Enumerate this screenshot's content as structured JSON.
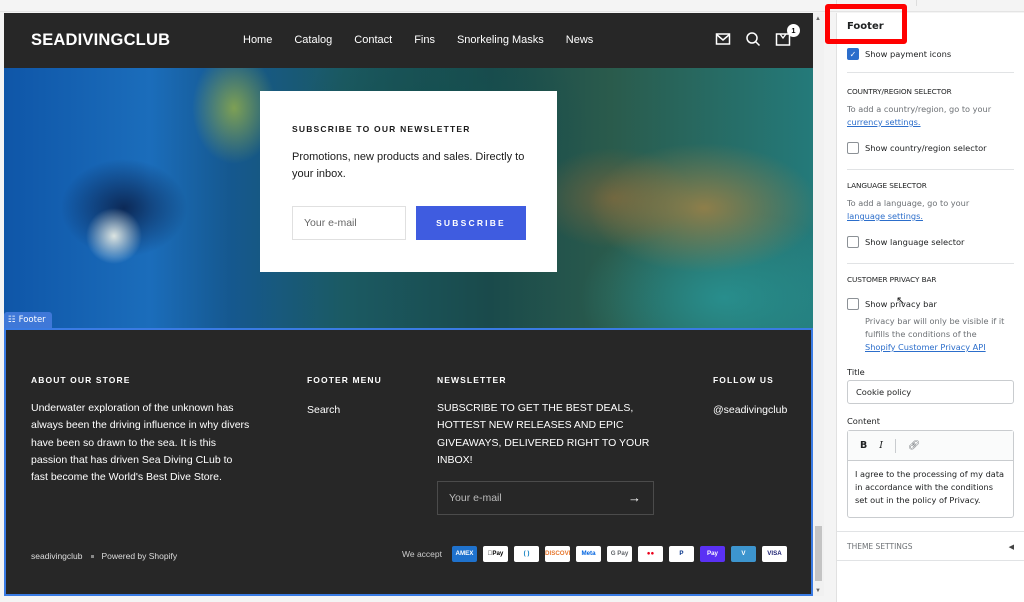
{
  "store": {
    "logo": "SEADIVINGCLUB",
    "nav": [
      "Home",
      "Catalog",
      "Contact",
      "Fins",
      "Snorkeling Masks",
      "News"
    ],
    "header_icons": [
      "mail-icon",
      "search-icon",
      "cart-icon"
    ],
    "cart_count": "1"
  },
  "hero_newsletter": {
    "title": "SUBSCRIBE TO OUR NEWSLETTER",
    "description": "Promotions, new products and sales. Directly to your inbox.",
    "email_placeholder": "Your e-mail",
    "button_label": "SUBSCRIBE",
    "button_color": "#3f5ce0"
  },
  "section_tag": "Footer",
  "footer": {
    "about": {
      "heading": "ABOUT OUR STORE",
      "text": "Underwater exploration of the unknown has always been the driving influence in why divers have been so drawn to the sea. It is this passion that has driven Sea Diving CLub to fast become the World's Best Dive Store."
    },
    "menu": {
      "heading": "FOOTER MENU",
      "links": [
        "Search"
      ]
    },
    "newsletter": {
      "heading": "NEWSLETTER",
      "text": "SUBSCRIBE TO GET THE BEST DEALS, HOTTEST NEW RELEASES AND EPIC GIVEAWAYS, DELIVERED RIGHT TO YOUR INBOX!",
      "email_placeholder": "Your e-mail",
      "submit_icon": "arrow-right-icon"
    },
    "follow": {
      "heading": "FOLLOW US",
      "handle": "@seadivingclub"
    },
    "copyright": "seadivingclub",
    "powered": "Powered by Shopify",
    "we_accept": "We accept",
    "payments": [
      {
        "name": "American Express",
        "label": "AMEX",
        "bg": "#1f72cd",
        "fg": "#ffffff"
      },
      {
        "name": "Apple Pay",
        "label": "Pay",
        "bg": "#ffffff",
        "fg": "#000000"
      },
      {
        "name": "Diners Club",
        "label": "( )",
        "bg": "#ffffff",
        "fg": "#0079be"
      },
      {
        "name": "Discover",
        "label": "DISCOVER",
        "bg": "#ffffff",
        "fg": "#e6772e"
      },
      {
        "name": "Meta Pay",
        "label": "Meta",
        "bg": "#ffffff",
        "fg": "#0064e0"
      },
      {
        "name": "Google Pay",
        "label": "G Pay",
        "bg": "#ffffff",
        "fg": "#5f6368"
      },
      {
        "name": "Mastercard",
        "label": "●●",
        "bg": "#ffffff",
        "fg": "#eb001b"
      },
      {
        "name": "PayPal",
        "label": "P",
        "bg": "#ffffff",
        "fg": "#003087"
      },
      {
        "name": "Shop Pay",
        "label": "Pay",
        "bg": "#5a31f4",
        "fg": "#ffffff"
      },
      {
        "name": "Venmo",
        "label": "V",
        "bg": "#3d95ce",
        "fg": "#ffffff"
      },
      {
        "name": "Visa",
        "label": "VISA",
        "bg": "#ffffff",
        "fg": "#1a1f71"
      }
    ]
  },
  "sidebar": {
    "title": "Footer",
    "show_payment_icons": {
      "label": "Show payment icons",
      "checked": true
    },
    "country": {
      "heading": "COUNTRY/REGION SELECTOR",
      "help": "To add a country/region, go to your",
      "link": "currency settings.",
      "checkbox": "Show country/region selector"
    },
    "language": {
      "heading": "LANGUAGE SELECTOR",
      "help": "To add a language, go to your",
      "link": "language settings.",
      "checkbox": "Show language selector"
    },
    "privacy": {
      "heading": "CUSTOMER PRIVACY BAR",
      "checkbox": "Show privacy bar",
      "help": "Privacy bar will only be visible if it fulfills the conditions of the",
      "link": "Shopify Customer Privacy API"
    },
    "title_field": {
      "label": "Title",
      "value": "Cookie policy"
    },
    "content_field": {
      "label": "Content",
      "toolbar": [
        "B",
        "I",
        "link-icon"
      ],
      "value": "I agree to the processing of my data in accordance with the conditions set out in the policy of Privacy."
    },
    "theme_settings": "THEME SETTINGS",
    "accent_color": "#2c6ecb"
  }
}
